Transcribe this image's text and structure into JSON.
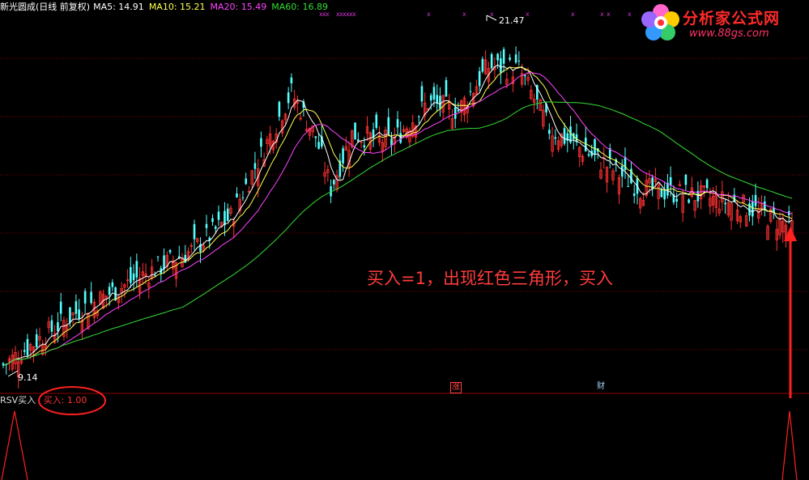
{
  "header": {
    "stock": "新光圆成(日线 前复权)",
    "ma5": "MA5: 14.91",
    "ma10": "MA10: 15.21",
    "ma20": "MA20: 15.49",
    "ma60": "MA60: 16.89"
  },
  "logo": {
    "title": "分析家公式网",
    "url": "www.88gs.com"
  },
  "annotation": "买入=1，出现红色三角形，买入",
  "indicator": {
    "name": "RSV买入",
    "value": "买入: 1.00"
  },
  "price_labels": {
    "high": "21.47",
    "low": "9.14"
  },
  "badges": {
    "zhang": "涨",
    "cai": "财"
  },
  "colors": {
    "up": "#ff3232",
    "down": "#54ffff",
    "ma5": "#ffffff",
    "ma10": "#ffff55",
    "ma20": "#ff44ff",
    "ma60": "#33dd33",
    "grid": "#8b0000",
    "signal": "#ff2020"
  },
  "chart_data": {
    "type": "candlestick",
    "price_axis_visible": [
      8.6,
      23.0
    ],
    "y_axis_labels_shown": false,
    "grid": true,
    "high_marker": 21.47,
    "low_marker": 9.14,
    "ma_current": {
      "MA5": 14.91,
      "MA10": 15.21,
      "MA20": 15.49,
      "MA60": 16.89
    },
    "indicator_panel": {
      "name": "RSV买入",
      "current": 1.0,
      "signals": [
        0,
        1
      ]
    }
  }
}
